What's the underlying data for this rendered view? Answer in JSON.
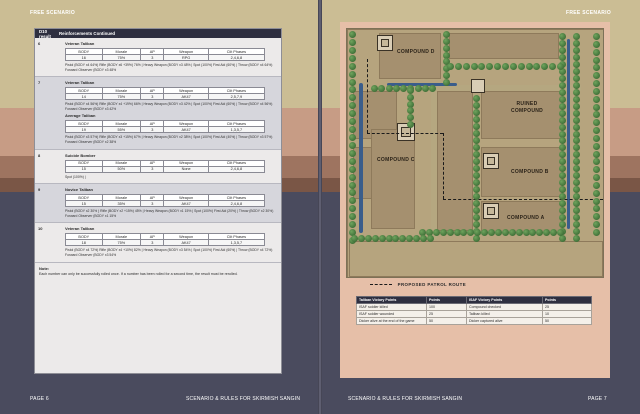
{
  "left_page": {
    "header": "FREE SCENARIO",
    "footer_page": "PAGE 6",
    "footer_title": "SCENARIO & RULES FOR SKIRMISH SANGIN",
    "table_head": {
      "col1": "D10 result",
      "col2": "Reinforcements Continued"
    },
    "stat_headers": [
      "BODY",
      "Morale",
      "AP",
      "Weapon",
      "Clit Phases"
    ],
    "rows": [
      {
        "num": "6",
        "units": [
          {
            "name": "Veteran Taliban",
            "stats": [
              "16",
              "75%",
              "3",
              "RPG",
              "2,4,6,8"
            ],
            "equip": "Pistol (BODY x4 64%) Rifle (BODY x6 +39%) 76% | Heavy Weapon (BODY x3 48% | Spot (100%) First Aid (60%) | Throw (BODY x4 64%) Forward Observer (BODY x3 48%"
          }
        ]
      },
      {
        "num": "7",
        "units": [
          {
            "name": "Veteran Taliban",
            "stats": [
              "14",
              "75%",
              "3",
              "AK47",
              "2,5,7,9"
            ],
            "equip": "Pistol (BODY x4 56%) Rifle (BODY x4 +19%) 66% | Heavy Weapon (BODY x3 42% | Spot (100%) First Aid (60%) | Throw (BODY x4 56%) Forward Observer (BODY x3 42%"
          },
          {
            "name": "Average Taliban",
            "stats": [
              "19",
              "55%",
              "3",
              "AK47",
              "1,3,5,7"
            ],
            "equip": "Pistol (BODY x3 57%) Rifle (BODY x3 +15%) 67% | Heavy Weapon (BODY x2 38% | Spot (100%) First Aid (40%) | Throw (BODY x3 57%) Forward Observer (BODY x2 38%"
          }
        ]
      },
      {
        "num": "8",
        "units": [
          {
            "name": "Suicide Bomber",
            "stats": [
              "15",
              "50%",
              "3",
              "None",
              "2,4,6,8"
            ],
            "equip": "Spot (100%) |"
          }
        ]
      },
      {
        "num": "9",
        "units": [
          {
            "name": "Novice Taliban",
            "stats": [
              "15",
              "35%",
              "3",
              "AK47",
              "2,4,6,8"
            ],
            "equip": "Pistol (BODY x2 30% ) Rifle (BODY x2 +15%) 45% | Heavy Weapon (BODY x1 15% | Spot (100%) First Aid (20%) | Throw (BODY x2 30%) Forward Observer (BODY x1 15%"
          }
        ]
      },
      {
        "num": "10",
        "units": [
          {
            "name": "Veteran Taliban",
            "stats": [
              "18",
              "75%",
              "3",
              "AK47",
              "1,3,5,7"
            ],
            "equip": "Pistol (BODY x4 72%) Rifle (BODY x4 +10%) 82% | Heavy Weapon (BODY x3 54% | Spot (100%) First Aid (60%) | Throw (BODY x4 72%) Forward Observer (BODY x3 54%"
          }
        ]
      }
    ],
    "note_title": "Note:",
    "note_text": "Each number can only be successfully rolled once. If a number has been rolled for a second time, the result must be rerolled."
  },
  "right_page": {
    "header": "FREE SCENARIO",
    "footer_page": "PAGE 7",
    "footer_title": "SCENARIO & RULES FOR SKIRMISH SANGIN",
    "map_labels": {
      "compound_d": "COMPOUND D",
      "ruined": "RUINED COMPOUND",
      "compound_c": "COMPOUND C",
      "compound_b": "COMPOUND B",
      "compound_a": "COMPOUND A"
    },
    "legend": "PROPOSED PATROL ROUTE",
    "vp_headers": [
      "Taliban Victory Points",
      "Points",
      "ISAF Victory Points",
      "Points"
    ],
    "vp_rows": [
      [
        "ISAF soldier killed",
        "100",
        "Compound checked",
        "25"
      ],
      [
        "ISAF soldier wounded",
        "25",
        "Taliban killed",
        "10"
      ],
      [
        "Dicker alive at the end of the game",
        "50",
        "Dicker captured alive",
        "50"
      ]
    ]
  },
  "colors": {
    "band_top": "#cbbd94",
    "band_pink": "#c79c85",
    "dark": "#4a4b5e",
    "table_header": "#2e2f40",
    "river": "#3a5d8b",
    "tree": "#2e5e2a"
  }
}
